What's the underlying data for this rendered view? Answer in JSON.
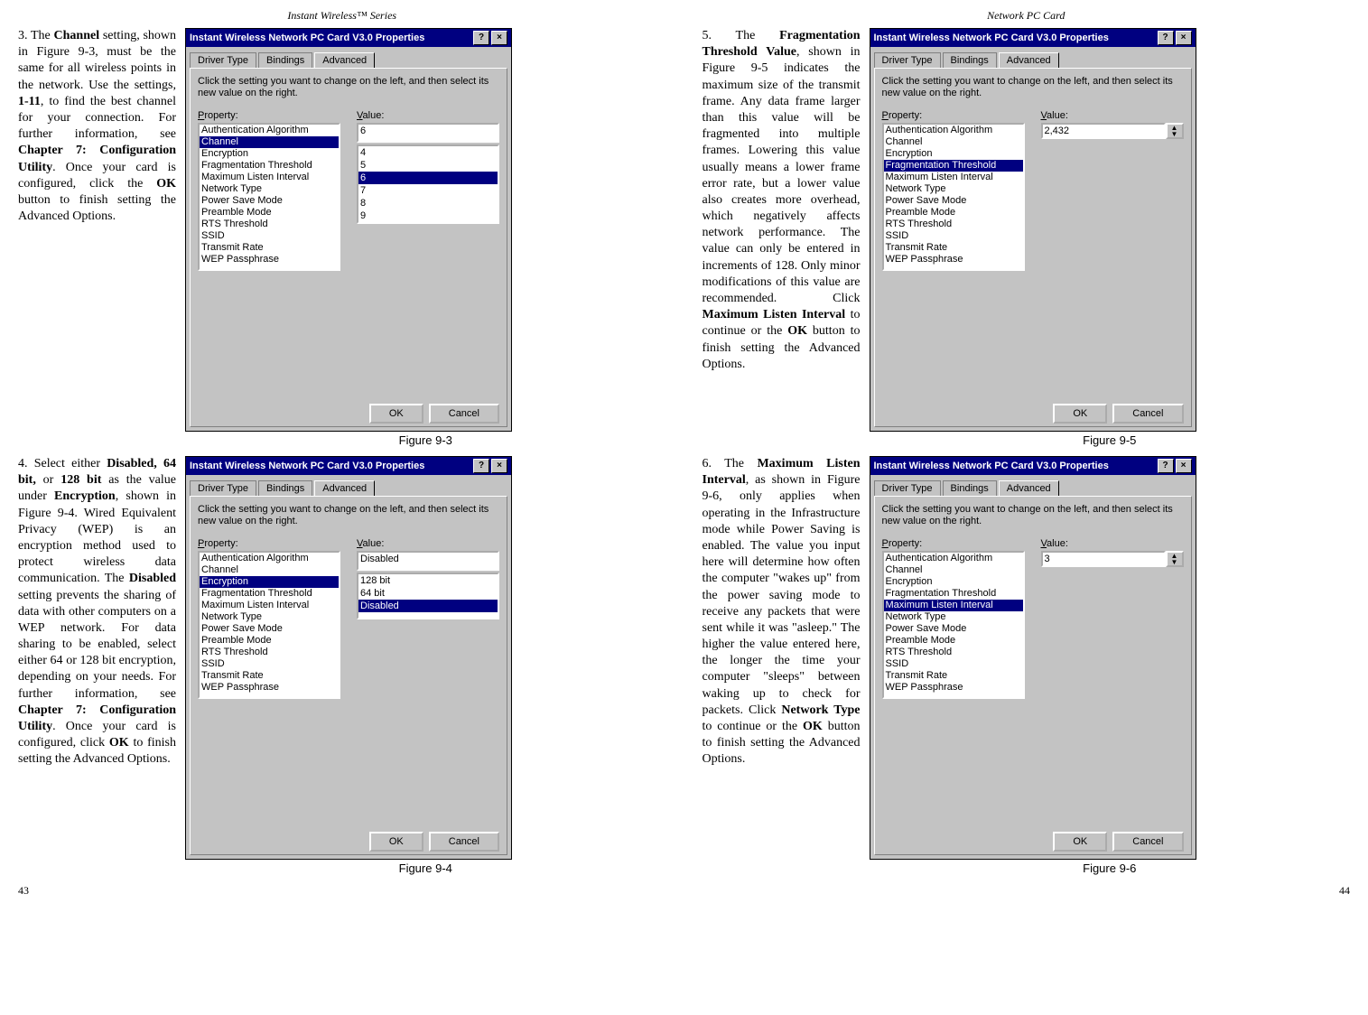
{
  "h1": "Instant Wireless™ Series",
  "h2": "Network PC Card",
  "p1": "43",
  "p2": "44",
  "cap3": "Figure 9-3",
  "cap4": "Figure 9-4",
  "cap5": "Figure 9-5",
  "cap6": "Figure 9-6",
  "dlgTitle": "Instant Wireless Network PC Card V3.0 Properties",
  "help": "?",
  "close": "×",
  "tab1": "Driver Type",
  "tab2": "Bindings",
  "tab3": "Advanced",
  "inst": "Click the setting you want to change on the left, and then select its new value on the right.",
  "plbl": "Property:",
  "vlbl": "Value:",
  "props": [
    "Authentication Algorithm",
    "Channel",
    "Encryption",
    "Fragmentation Threshold",
    "Maximum Listen Interval",
    "Network Type",
    "Power Save Mode",
    "Preamble Mode",
    "RTS Threshold",
    "SSID",
    "Transmit Rate",
    "WEP Passphrase"
  ],
  "v3": "6",
  "v3l": [
    "4",
    "5",
    "6",
    "7",
    "8",
    "9"
  ],
  "v4": "Disabled",
  "v4l": [
    "128 bit",
    "64 bit",
    "Disabled"
  ],
  "v5": "2,432",
  "v6": "3",
  "ok": "OK",
  "cancel": "Cancel",
  "t3a": "3. The ",
  "t3b": "Channel",
  "t3c": " setting, shown in Figure 9-3, must be the same for all wireless points in the network. Use the settings, ",
  "t3d": "1-11",
  "t3e": ", to find the best channel for your connection. For further information, see ",
  "t3f": "Chapter 7: Configuration Utility",
  "t3g": ". Once your card is configured, click the ",
  "t3h": "OK",
  "t3i": " button to finish setting the Advanced Options.",
  "t4a": "4. Select either ",
  "t4b": "Disabled, 64 bit,",
  "t4c": " or ",
  "t4d": "128 bit",
  "t4e": " as the value under ",
  "t4f": "Encryption",
  "t4g": ", shown in Figure 9-4. Wired Equivalent Privacy (WEP) is an encryption method used to protect wireless data communication. The ",
  "t4h": "Disabled",
  "t4i": " setting prevents the sharing of data with other computers on a WEP network. For data sharing to be enabled, select either 64 or 128 bit encryption, depending on your needs. For further information, see ",
  "t4j": "Chapter 7: Configuration Utility",
  "t4k": ". Once your card is configured, click ",
  "t4l": "OK",
  "t4m": " to finish setting the Advanced Options.",
  "t5a": "5. The ",
  "t5b": "Fragmentation Threshold Value",
  "t5c": ", shown in Figure 9-5 indicates the maximum size of the transmit frame. Any data frame larger than this value will be fragmented into multiple frames. Lowering this value usually means a lower frame error rate, but a lower value also creates more overhead, which negatively affects network performance. The value can only be entered in increments of 128. Only minor modifications of this value are recommended. Click ",
  "t5d": "Maximum Listen Interval",
  "t5e": " to continue or the ",
  "t5f": "OK",
  "t5g": " button to finish setting the Advanced Options.",
  "t6a": "6. The ",
  "t6b": "Maximum Listen Interval",
  "t6c": ", as shown in Figure 9-6, only applies when operating in the Infrastructure mode while Power Saving is enabled. The value you input here will determine how often the computer \"wakes up\" from the power saving mode to receive any packets that were sent while it was \"asleep.\" The higher the value entered here, the longer the time your computer \"sleeps\" between waking up to check for packets. Click ",
  "t6d": "Network Type",
  "t6e": " to continue or the ",
  "t6f": "OK",
  "t6g": " button to finish setting the Advanced Options."
}
